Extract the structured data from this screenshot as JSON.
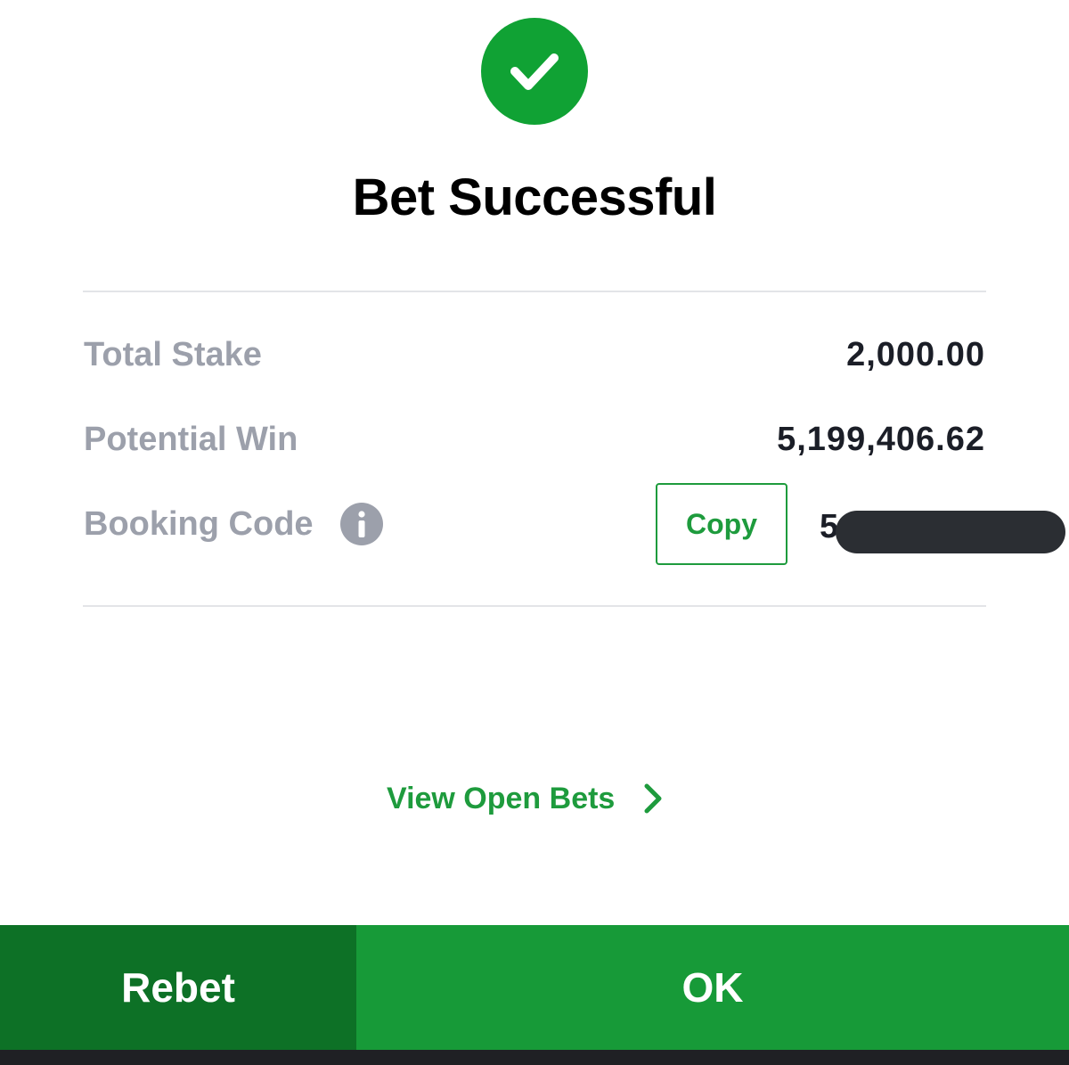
{
  "header": {
    "title": "Bet Successful"
  },
  "summary": {
    "total_stake_label": "Total Stake",
    "total_stake_value": "2,000.00",
    "potential_win_label": "Potential Win",
    "potential_win_value": "5,199,406.62",
    "booking_code_label": "Booking Code",
    "booking_code_visible": "5",
    "copy_label": "Copy"
  },
  "links": {
    "view_open_bets": "View Open Bets"
  },
  "footer": {
    "rebet_label": "Rebet",
    "ok_label": "OK"
  },
  "icons": {
    "success": "check-circle-icon",
    "info": "info-icon",
    "chevron": "chevron-right-icon"
  },
  "colors": {
    "brand_green": "#10a234",
    "link_green": "#1e9b3d",
    "rebet_bg": "#0d7126",
    "ok_bg": "#179a38",
    "label_gray": "#9ca0ab",
    "value_dark": "#1b1e27"
  }
}
